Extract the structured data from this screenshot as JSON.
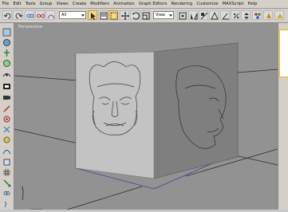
{
  "menu": {
    "items": [
      "File",
      "Edit",
      "Tools",
      "Group",
      "Views",
      "Create",
      "Modifiers",
      "Animation",
      "Graph Editors",
      "Rendering",
      "Customize",
      "MAXScript",
      "Help"
    ]
  },
  "toolbar": {
    "selection_filter": "All",
    "reference_coord": "View",
    "icons": [
      "undo-icon",
      "redo-icon",
      "select-link-icon",
      "unlink-icon",
      "bind-space-warp-icon",
      "selection-filter-dropdown",
      "select-object-icon",
      "select-by-name-icon",
      "rectangular-selection-icon",
      "select-and-move-icon",
      "select-and-rotate-icon",
      "select-and-scale-icon",
      "reference-coordinate-dropdown",
      "pivot-center-icon",
      "mirror-icon",
      "align-icon",
      "named-selection-icon",
      "angle-snap-icon",
      "percent-snap-icon",
      "spinner-snap-icon",
      "material-editor-icon",
      "render-icon"
    ]
  },
  "left_toolbar": {
    "icons": [
      "create-icon",
      "modify-icon",
      "hierarchy-icon",
      "motion-icon",
      "display-icon",
      "utilities-icon",
      "camera-icon",
      "light-icon",
      "helper-icon",
      "space-warp-icon",
      "systems-icon",
      "shapes-icon",
      "geometry-icon",
      "grid-icon",
      "snap-icon",
      "link-icon",
      "bone-icon",
      "particle-icon",
      "cloth-icon",
      "hair-icon",
      "brush-icon"
    ]
  },
  "viewport": {
    "label": "Perspective",
    "background": "#929292",
    "grid_color": "#2a2a2a",
    "front_plane_color": "#c3c3c3",
    "side_plane_color": "#7f7f7f",
    "selection_box_color": "#3f3f9a"
  }
}
